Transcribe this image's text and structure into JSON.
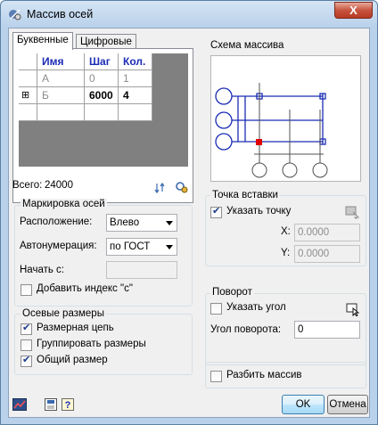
{
  "window": {
    "title": "Массив осей",
    "close_label": "X"
  },
  "tabs": [
    {
      "label": "Буквенные"
    },
    {
      "label": "Цифровые"
    }
  ],
  "grid": {
    "headers": [
      "Имя",
      "Шаг",
      "Кол."
    ],
    "rows": [
      {
        "expander": "",
        "name": "А",
        "step": "0",
        "count": "1"
      },
      {
        "expander": "⊞",
        "name": "Б",
        "step": "6000",
        "count": "4"
      }
    ]
  },
  "total": {
    "label": "Всего:",
    "value": "24000"
  },
  "axis_marking": {
    "title": "Маркировка осей",
    "position_label": "Расположение:",
    "position_value": "Влево",
    "autonum_label": "Автонумерация:",
    "autonum_value": "по ГОСТ",
    "start_label": "Начать с:",
    "start_value": "",
    "add_index_label": "Добавить индекс \"c\"",
    "add_index_checked": false
  },
  "dimensions": {
    "title": "Осевые размеры",
    "items": [
      {
        "label": "Размерная цепь",
        "checked": true
      },
      {
        "label": "Группировать размеры",
        "checked": false
      },
      {
        "label": "Общий размер",
        "checked": true
      }
    ]
  },
  "scheme": {
    "title": "Схема массива"
  },
  "insert_point": {
    "title": "Точка вставки",
    "specify_label": "Указать точку",
    "specify_checked": true,
    "x_label": "X:",
    "x_value": "0.0000",
    "y_label": "Y:",
    "y_value": "0.0000"
  },
  "rotation": {
    "title": "Поворот",
    "specify_label": "Указать угол",
    "specify_checked": false,
    "angle_label": "Угол поворота:",
    "angle_value": "0"
  },
  "explode": {
    "label": "Разбить массив",
    "checked": false
  },
  "footer": {
    "ok_label": "OK",
    "cancel_label": "Отмена"
  },
  "colors": {
    "accent_blue": "#1b2cb5",
    "marker_red": "#e00000"
  }
}
